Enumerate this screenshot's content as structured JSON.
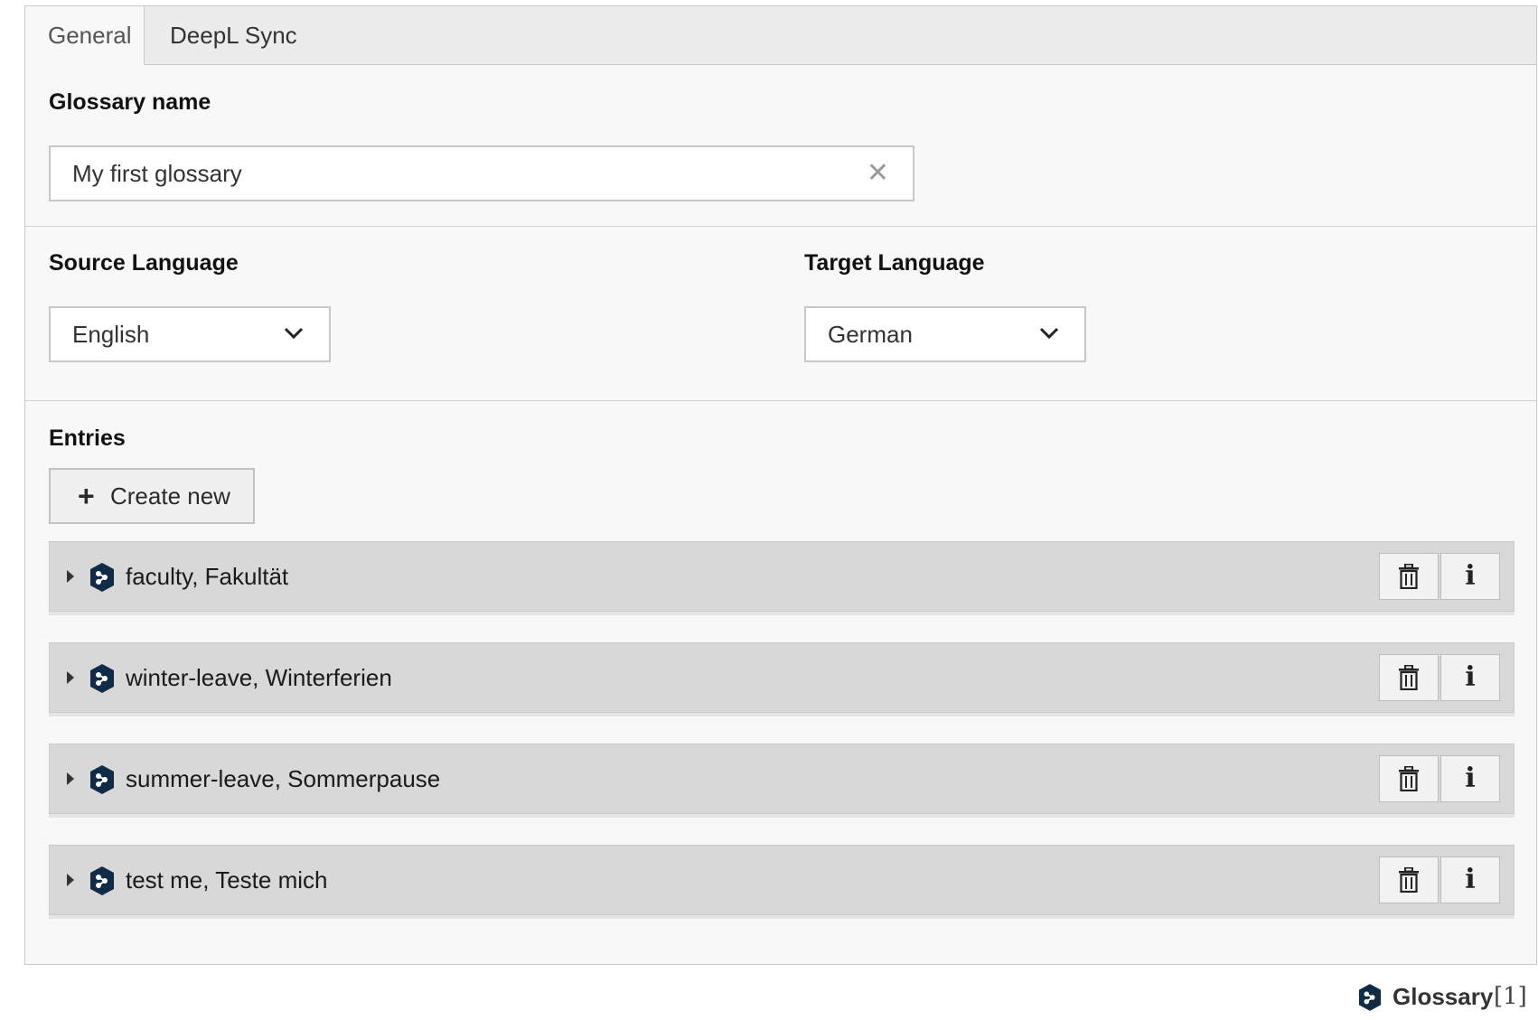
{
  "tabs": [
    {
      "label": "General",
      "active": true
    },
    {
      "label": "DeepL Sync",
      "active": false
    }
  ],
  "glossary": {
    "label": "Glossary name",
    "value": "My first glossary",
    "clear_icon": "close-icon"
  },
  "languages": {
    "source_label": "Source Language",
    "source_value": "English",
    "target_label": "Target Language",
    "target_value": "German"
  },
  "entries": {
    "label": "Entries",
    "create_label": "Create new",
    "items": [
      {
        "title": "faculty, Fakultät"
      },
      {
        "title": "winter-leave, Winterferien"
      },
      {
        "title": "summer-leave, Sommerpause"
      },
      {
        "title": "test me, Teste mich"
      }
    ],
    "info_glyph": "i"
  },
  "footer": {
    "name": "Glossary",
    "count": "[1]"
  },
  "colors": {
    "logo": "#0f2b46",
    "panel_bg": "#f8f8f8",
    "entry_bg": "#d8d8d8"
  }
}
